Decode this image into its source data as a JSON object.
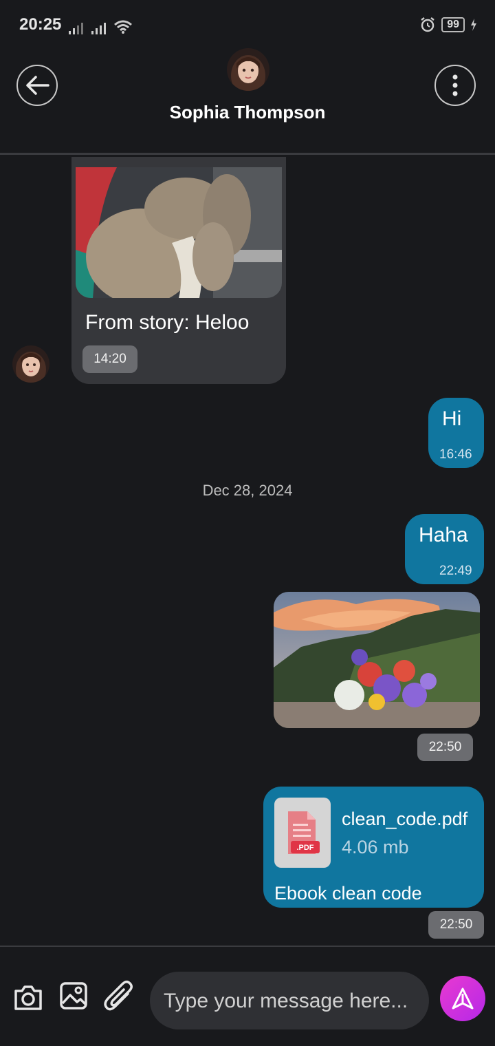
{
  "status_bar": {
    "time": "20:25",
    "battery": "99"
  },
  "header": {
    "contact_name": "Sophia Thompson",
    "back_icon": "arrow-left-icon",
    "menu_icon": "more-vertical-icon"
  },
  "messages": {
    "story_reply": {
      "text": "From story: Heloo",
      "time": "14:20"
    },
    "hi": {
      "text": "Hi",
      "time": "16:46"
    },
    "date_separator": "Dec 28, 2024",
    "haha": {
      "text": "Haha",
      "time": "22:49"
    },
    "image_msg": {
      "time": "22:50"
    },
    "file_msg": {
      "file_name": "clean_code.pdf",
      "file_size": "4.06 mb",
      "file_badge": ".PDF",
      "caption": "Ebook clean code",
      "time": "22:50"
    }
  },
  "composer": {
    "placeholder": "Type your message here...",
    "icons": [
      "camera-icon",
      "image-icon",
      "paperclip-icon",
      "send-icon"
    ]
  },
  "colors": {
    "background": "#18191c",
    "incoming_bubble": "#36373b",
    "outgoing_bubble": "#10769f",
    "send_button": "#d633dc"
  }
}
